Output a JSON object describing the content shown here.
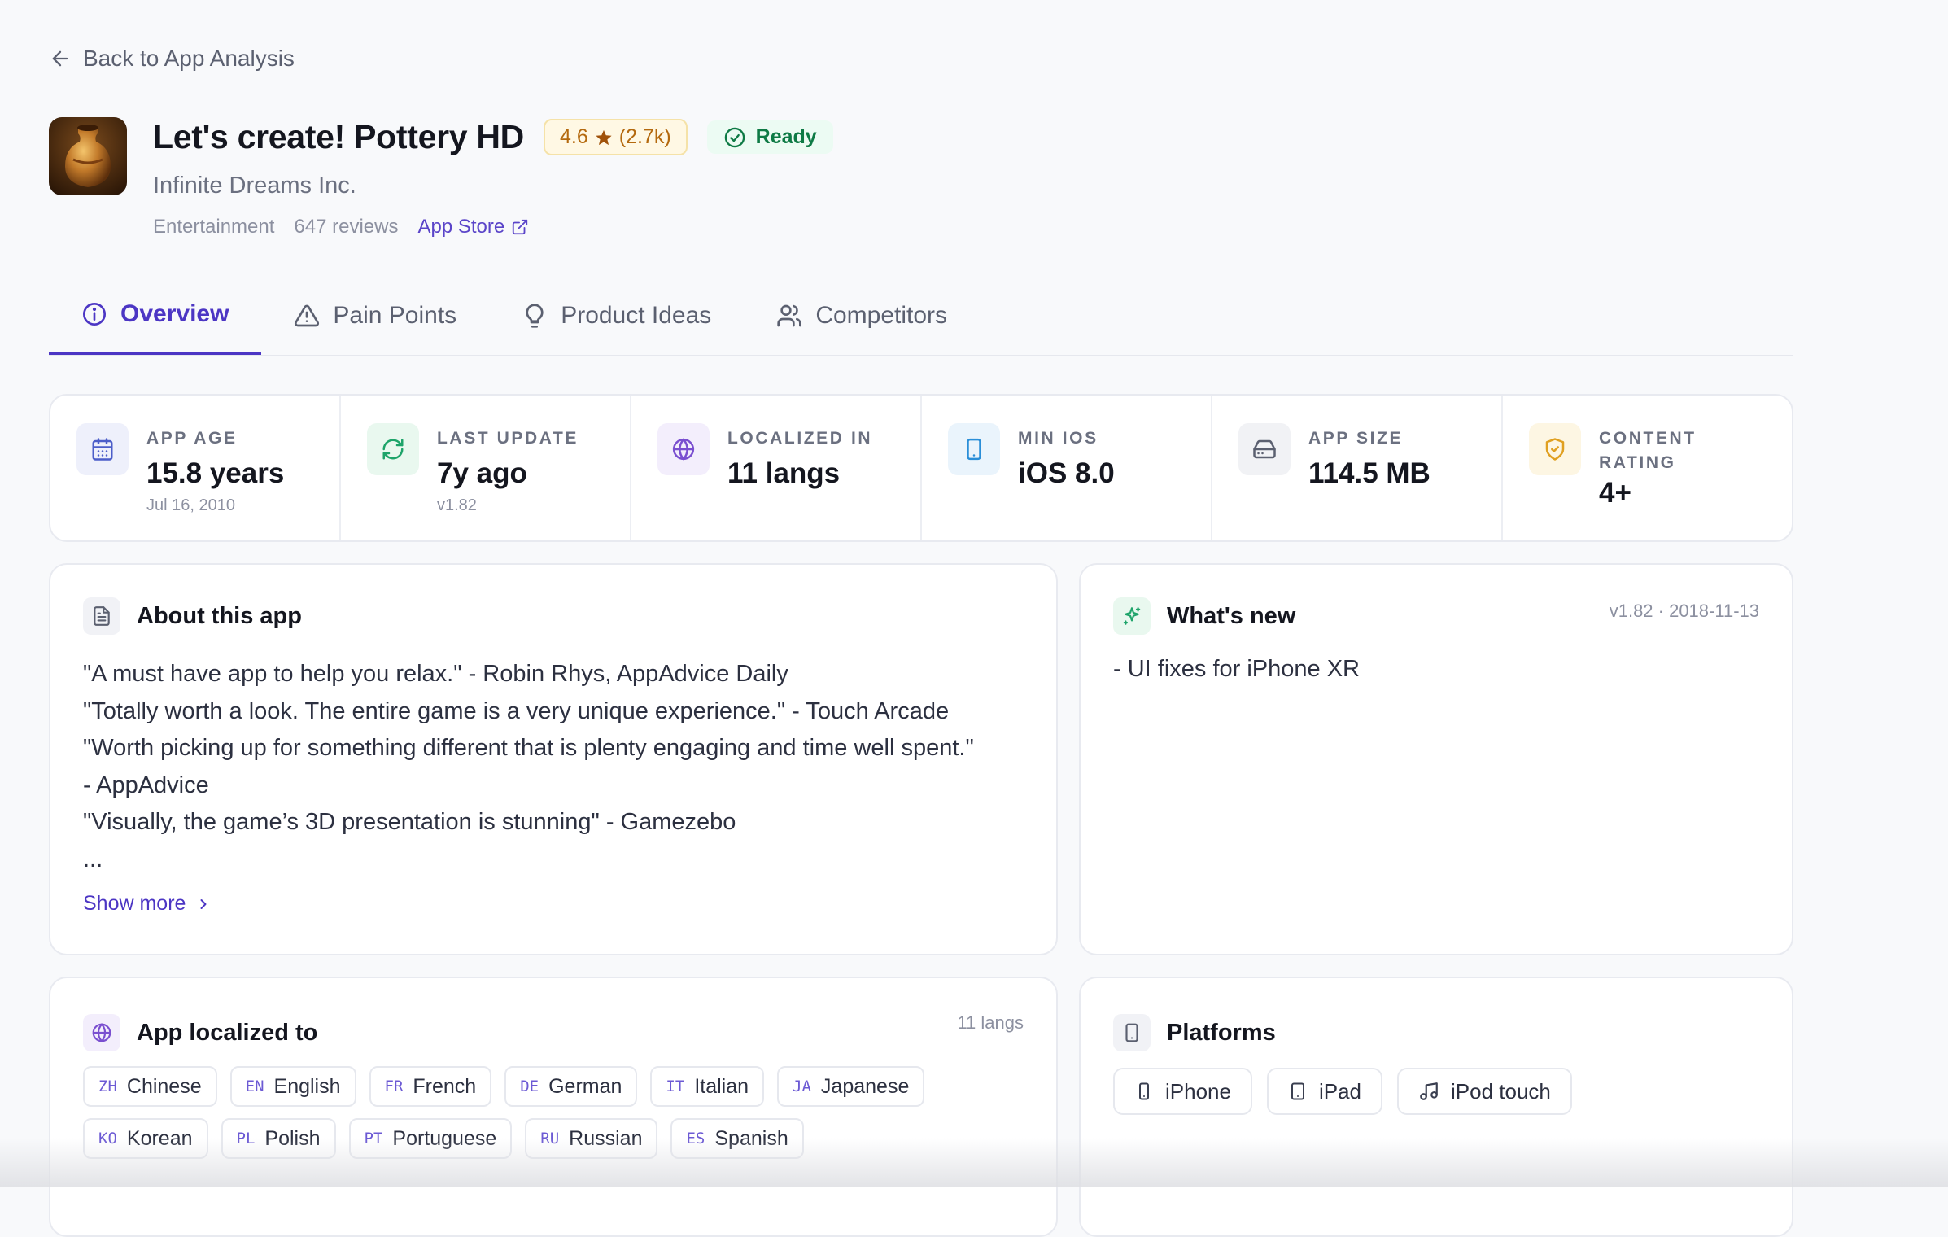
{
  "nav": {
    "back_label": "Back to App Analysis"
  },
  "app": {
    "title": "Let's create! Pottery HD",
    "rating": "4.6",
    "rating_count": "(2.7k)",
    "status": "Ready",
    "developer": "Infinite Dreams Inc.",
    "category": "Entertainment",
    "reviews": "647 reviews",
    "store_link": "App Store"
  },
  "tabs": [
    {
      "label": "Overview",
      "icon": "info-icon",
      "active": true
    },
    {
      "label": "Pain Points",
      "icon": "warning-icon",
      "active": false
    },
    {
      "label": "Product Ideas",
      "icon": "lightbulb-icon",
      "active": false
    },
    {
      "label": "Competitors",
      "icon": "users-icon",
      "active": false
    }
  ],
  "stats": [
    {
      "label": "APP AGE",
      "value": "15.8 years",
      "sub": "Jul 16, 2010",
      "icon": "calendar-icon",
      "color": "#4c5ec9"
    },
    {
      "label": "LAST UPDATE",
      "value": "7y ago",
      "sub": "v1.82",
      "icon": "refresh-icon",
      "color": "#1ea46a"
    },
    {
      "label": "LOCALIZED IN",
      "value": "11 langs",
      "sub": "",
      "icon": "globe-icon",
      "color": "#7a4fd0"
    },
    {
      "label": "MIN IOS",
      "value": "iOS 8.0",
      "sub": "",
      "icon": "tablet-icon",
      "color": "#2a8ed8"
    },
    {
      "label": "APP SIZE",
      "value": "114.5 MB",
      "sub": "",
      "icon": "hard-drive-icon",
      "color": "#5b6070"
    },
    {
      "label": "CONTENT\nRATING",
      "value": "4+",
      "sub": "",
      "icon": "shield-check-icon",
      "color": "#e0a021"
    }
  ],
  "about": {
    "title": "About this app",
    "lines": [
      "\"A must have app to help you relax.\" - Robin Rhys, AppAdvice Daily",
      "\"Totally worth a look. The entire game is a very unique experience.\" - Touch Arcade",
      "\"Worth picking up for something different that is plenty engaging and time well spent.\"",
      "- AppAdvice",
      "\"Visually, the game’s 3D presentation is stunning\" - Gamezebo",
      "..."
    ],
    "show_more": "Show more"
  },
  "whats_new": {
    "title": "What's new",
    "version_date": "v1.82 · 2018-11-13",
    "text": "- UI fixes for iPhone XR"
  },
  "localized": {
    "title": "App localized to",
    "count": "11 langs",
    "languages": [
      {
        "code": "ZH",
        "name": "Chinese"
      },
      {
        "code": "EN",
        "name": "English"
      },
      {
        "code": "FR",
        "name": "French"
      },
      {
        "code": "DE",
        "name": "German"
      },
      {
        "code": "IT",
        "name": "Italian"
      },
      {
        "code": "JA",
        "name": "Japanese"
      },
      {
        "code": "KO",
        "name": "Korean"
      },
      {
        "code": "PL",
        "name": "Polish"
      },
      {
        "code": "PT",
        "name": "Portuguese"
      },
      {
        "code": "RU",
        "name": "Russian"
      },
      {
        "code": "ES",
        "name": "Spanish"
      }
    ]
  },
  "platforms": {
    "title": "Platforms",
    "items": [
      {
        "label": "iPhone",
        "icon": "phone-icon"
      },
      {
        "label": "iPad",
        "icon": "tablet-icon"
      },
      {
        "label": "iPod touch",
        "icon": "music-icon"
      }
    ]
  },
  "colors": {
    "accent": "#4c36c4",
    "rating_text": "#b4690e",
    "ready_text": "#0e7a45"
  }
}
